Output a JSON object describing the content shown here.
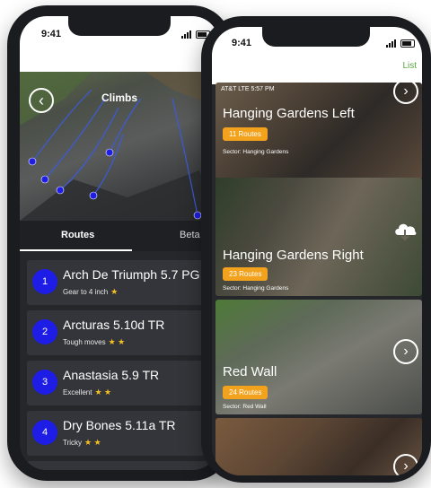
{
  "left_phone": {
    "status_time": "9:41",
    "header_title": "Climbs",
    "tabs": [
      {
        "label": "Routes",
        "active": true
      },
      {
        "label": "Beta",
        "active": false
      }
    ],
    "routes": [
      {
        "number": "1",
        "name": "Arch De Triumph 5.7 PG",
        "desc": "Gear to 4 inch",
        "stars": "★"
      },
      {
        "number": "2",
        "name": "Arcturas 5.10d TR",
        "desc": "Tough moves",
        "stars": "★ ★"
      },
      {
        "number": "3",
        "name": "Anastasia 5.9 TR",
        "desc": "Excellent",
        "stars": "★ ★"
      },
      {
        "number": "4",
        "name": "Dry Bones 5.11a TR",
        "desc": "Tricky",
        "stars": "★ ★"
      }
    ],
    "photo_markers": [
      "1",
      "2",
      "3",
      "4",
      "5",
      "6"
    ]
  },
  "right_phone": {
    "status_time": "9:41",
    "list_link": "List",
    "inner_status": "AT&T  LTE          5:57 PM",
    "areas": [
      {
        "name": "Hanging Gardens Left",
        "routes_badge": "11 Routes",
        "sector": "Sector: Hanging Gardens",
        "action_icon": "chevron-right-icon"
      },
      {
        "name": "Hanging Gardens Right",
        "routes_badge": "23 Routes",
        "sector": "Sector: Hanging Gardens",
        "action_icon": "cloud-download-icon"
      },
      {
        "name": "Red Wall",
        "routes_badge": "24 Routes",
        "sector": "Sector: Red Wall",
        "action_icon": "chevron-right-icon"
      },
      {
        "name": "",
        "routes_badge": "",
        "sector": "",
        "action_icon": "chevron-right-icon"
      }
    ]
  },
  "colors": {
    "route_number_bg": "#1d1de6",
    "badge": "#f2a21d",
    "star": "#f4c020",
    "list_link": "#5aa742",
    "dark_bg": "#26272b"
  }
}
